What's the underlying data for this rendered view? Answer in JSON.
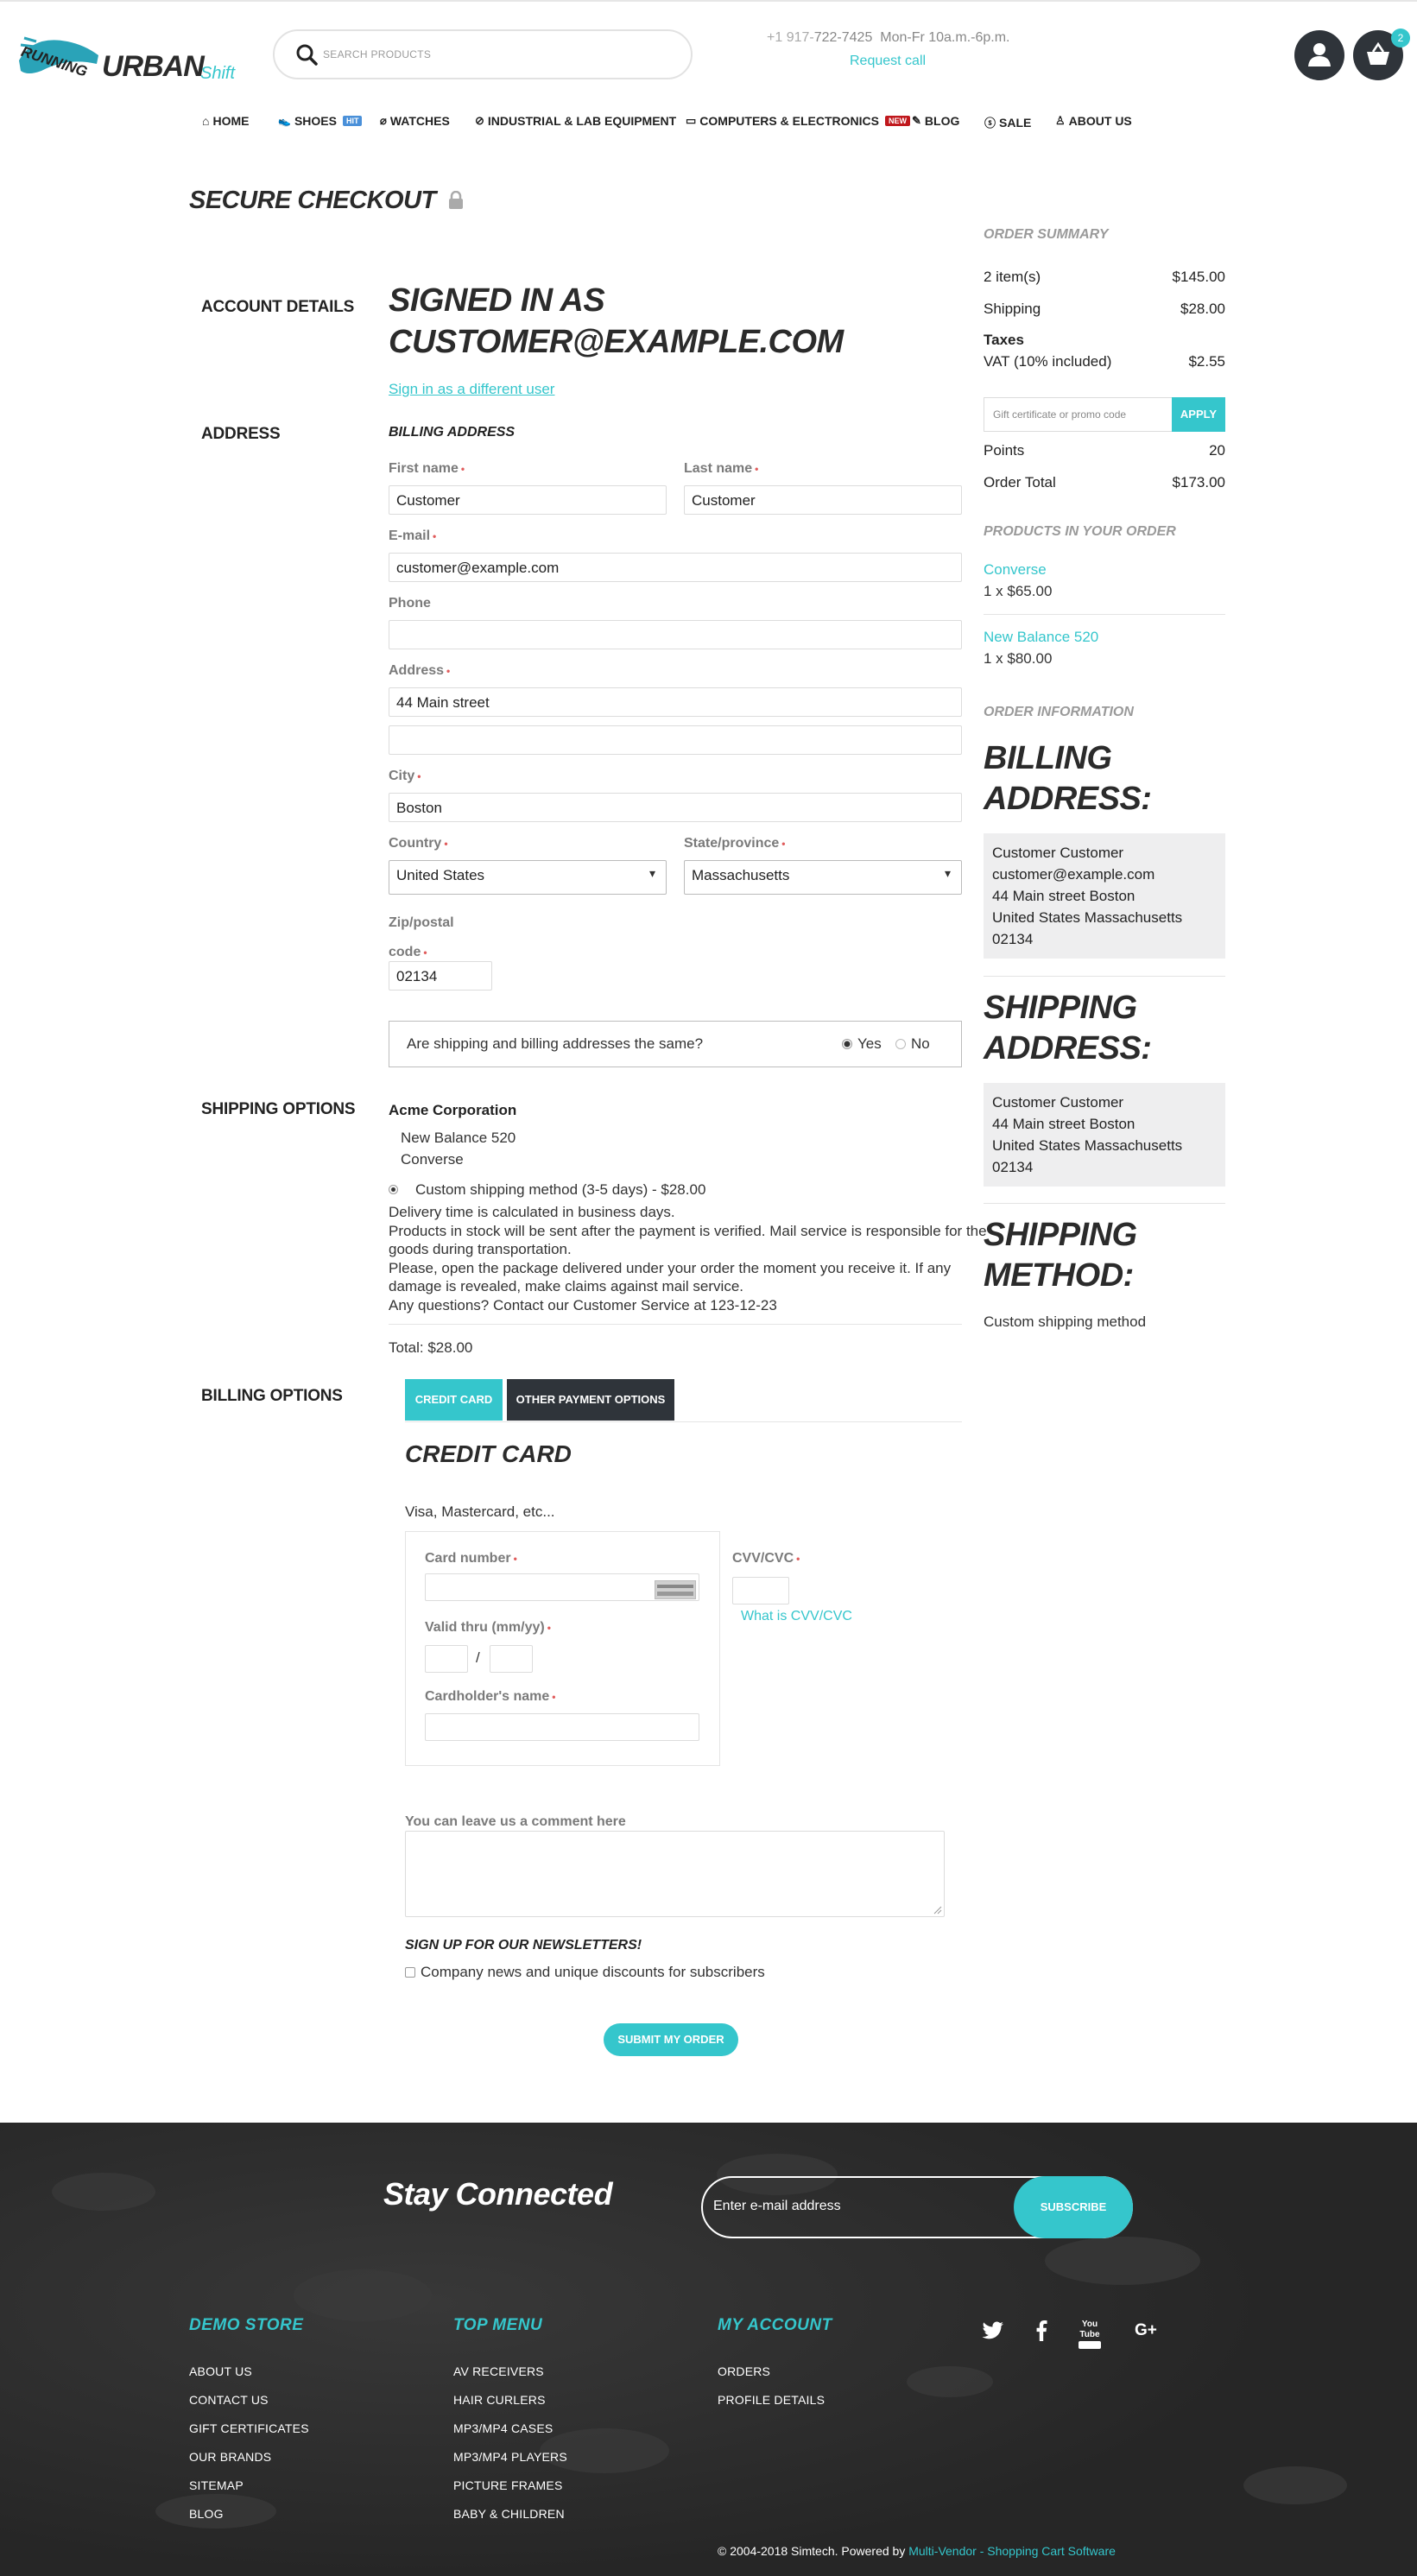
{
  "header": {
    "logo_top": "RUNNING",
    "logo_main": "URBAN",
    "logo_sub": "Shift",
    "search_placeholder": "SEARCH PRODUCTS",
    "phone_prefix": "+1 917-",
    "phone_rest": "722-7425",
    "hours": "Mon-Fr 10a.m.-6p.m.",
    "request_call": "Request call",
    "cart_count": "2"
  },
  "nav": [
    {
      "label": "HOME",
      "icon": "home-icon"
    },
    {
      "label": "SHOES",
      "icon": "shoe-icon",
      "badge": "HIT",
      "badge_color": "#4a90d9"
    },
    {
      "label": "WATCHES",
      "icon": "tag-icon"
    },
    {
      "label": "INDUSTRIAL & LAB EQUIPMENT",
      "icon": "link-icon"
    },
    {
      "label": "COMPUTERS & ELECTRONICS",
      "icon": "computer-icon",
      "badge": "NEW",
      "badge_color": "#c0181d"
    },
    {
      "label": "BLOG",
      "icon": "pencil-icon"
    },
    {
      "label": "SALE",
      "icon": "dollar-icon"
    },
    {
      "label": "ABOUT US",
      "icon": "person-icon"
    }
  ],
  "page_title": "SECURE CHECKOUT",
  "account": {
    "section_label": "ACCOUNT DETAILS",
    "signed_in_line1": "SIGNED IN AS",
    "signed_in_line2": "CUSTOMER@EXAMPLE.COM",
    "sign_in_different": "Sign in as a different user"
  },
  "address": {
    "section_label": "ADDRESS",
    "billing_heading": "BILLING ADDRESS",
    "first_name_label": "First name",
    "first_name": "Customer",
    "last_name_label": "Last name",
    "last_name": "Customer",
    "email_label": "E-mail",
    "email": "customer@example.com",
    "phone_label": "Phone",
    "phone": "",
    "address_label": "Address",
    "address1": "44 Main street",
    "address2": "",
    "city_label": "City",
    "city": "Boston",
    "country_label": "Country",
    "country": "United States",
    "state_label": "State/province",
    "state": "Massachusetts",
    "zip_label_1": "Zip/postal",
    "zip_label_2": "code",
    "zip": "02134",
    "same_question": "Are shipping and billing addresses the same?",
    "yes": "Yes",
    "no": "No"
  },
  "shipping": {
    "section_label": "SHIPPING OPTIONS",
    "vendor": "Acme Corporation",
    "items": [
      "New Balance 520",
      "Converse"
    ],
    "method": "Custom shipping method (3-5 days) - $28.00",
    "desc": [
      "Delivery time is calculated in business days.",
      "Products in stock will be sent after the payment is verified. Mail service is responsible for the",
      "goods during transportation.",
      "Please, open the package delivered under your order the moment you receive it. If any",
      "damage is revealed, make claims against mail service.",
      "Any questions? Contact our Customer Service at 123-12-23"
    ],
    "total": "Total: $28.00"
  },
  "billing": {
    "section_label": "BILLING OPTIONS",
    "tab_credit": "CREDIT CARD",
    "tab_other": "OTHER PAYMENT OPTIONS",
    "heading": "CREDIT CARD",
    "cards": "Visa, Mastercard, etc...",
    "card_number_label": "Card number",
    "valid_thru_label": "Valid thru (mm/yy)",
    "slash": "/",
    "holder_label": "Cardholder's name",
    "cvv_label": "CVV/CVC",
    "what_cvv": "What is CVV/CVC",
    "comment_label": "You can leave us a comment here",
    "newsletter_heading": "SIGN UP FOR OUR NEWSLETTERS!",
    "newsletter_option": "Company news and unique discounts for subscribers",
    "submit": "SUBMIT MY ORDER"
  },
  "summary": {
    "heading": "ORDER SUMMARY",
    "items_label": "2 item(s)",
    "items_value": "$145.00",
    "shipping_label": "Shipping",
    "shipping_value": "$28.00",
    "taxes_label": "Taxes",
    "vat_label": "VAT (10% included)",
    "vat_value": "$2.55",
    "promo_placeholder": "Gift certificate or promo code",
    "apply": "APPLY",
    "points_label": "Points",
    "points_value": "20",
    "total_label": "Order Total",
    "total_value": "$173.00",
    "products_heading": "PRODUCTS IN YOUR ORDER",
    "products": [
      {
        "name": "Converse",
        "qty": "1 x $65.00"
      },
      {
        "name": "New Balance 520",
        "qty": "1 x $80.00"
      }
    ],
    "info_heading": "ORDER INFORMATION",
    "billing_title_1": "BILLING",
    "billing_title_2": "ADDRESS:",
    "billing_lines": [
      "Customer Customer",
      "customer@example.com",
      "44 Main street Boston",
      "United States Massachusetts",
      "02134"
    ],
    "shipping_title_1": "SHIPPING",
    "shipping_title_2": "ADDRESS:",
    "shipping_lines": [
      "Customer Customer",
      "44 Main street Boston",
      "United States Massachusetts",
      "02134"
    ],
    "method_title_1": "SHIPPING",
    "method_title_2": "METHOD:",
    "method_value": "Custom shipping method"
  },
  "footer": {
    "stay_connected": "Stay Connected",
    "email_placeholder": "Enter e-mail address",
    "subscribe": "SUBSCRIBE",
    "col1_title": "DEMO STORE",
    "col1": [
      "ABOUT US",
      "CONTACT US",
      "GIFT CERTIFICATES",
      "OUR BRANDS",
      "SITEMAP",
      "BLOG"
    ],
    "col2_title": "TOP MENU",
    "col2": [
      "AV RECEIVERS",
      "HAIR CURLERS",
      "MP3/MP4 CASES",
      "MP3/MP4 PLAYERS",
      "PICTURE FRAMES",
      "BABY & CHILDREN"
    ],
    "col3_title": "MY ACCOUNT",
    "col3": [
      "ORDERS",
      "PROFILE DETAILS"
    ],
    "social": [
      "twitter-icon",
      "facebook-icon",
      "youtube-icon",
      "google-plus-icon"
    ],
    "social_labels": [
      "You Tube",
      "G+"
    ],
    "copyright": "© 2004-2018 Simtech.  Powered by ",
    "powered_link": "Multi-Vendor - Shopping Cart Software"
  },
  "colors": {
    "accent": "#35c6cc",
    "dark": "#2f343a",
    "hit_badge": "#4a90d9",
    "new_badge": "#c0181d"
  }
}
